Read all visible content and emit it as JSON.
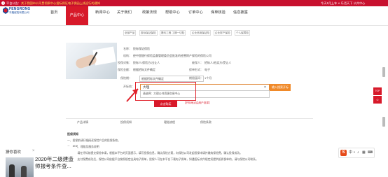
{
  "notice": {
    "icon": "!",
    "text_lead": "平台公告：",
    "text_highlight": "关于我国市公司贯彻原中心投标保证电子保函上线运行的通知",
    "right": "今天1月上年 ∨ 乐活天下 公共中心"
  },
  "brand": {
    "name": "FENGRONG",
    "subtitle": "丰融保险有限公司"
  },
  "nav": {
    "items": [
      "首页",
      "新闻中心",
      "关于我们",
      "政策法规",
      "帮助中心",
      "订单中心",
      "保单核验",
      "信息披露"
    ],
    "active": "产品中心"
  },
  "categories": [
    "全部产品",
    "投标保证保险",
    "履约工程 工期一切险",
    "企业信用保证险",
    "企业财产保险",
    "个人保障险"
  ],
  "product": {
    "fields": [
      {
        "label": "名称：",
        "value": "投标保证保险"
      },
      {
        "label": "机构：",
        "value": "经中国银行保险监督管理委员会批准的经营财产保险的保险公司"
      },
      {
        "label": "投保对象：",
        "value": "投标人/保险方/出让人",
        "extra_label": "被保人：",
        "extra_value": "招标人/拍卖方/受让人"
      },
      {
        "label": "保险金额：",
        "value": "根据招标文件确定",
        "extra_label": "保单形式：",
        "extra_value": "电子"
      },
      {
        "label": "保险期：",
        "value": "根据招标文件确定",
        "extra_label": "期限区间：",
        "extra_value": "1个月"
      }
    ],
    "select_label": "开标地：",
    "search_value": "大理",
    "search_clear": "×",
    "search_button": "输入搜索开标",
    "dropdown_lead": "大理",
    "dropdown_item": "请选择：大理公共资源交易中心",
    "hint": "开标地点请按照招标文件",
    "submit": "点击购买",
    "submit_note": "【开标地点由用户选择】"
  },
  "detail_tabs": [
    "产品详情",
    "投保须知",
    "理赔流程",
    "保险条款"
  ],
  "content": {
    "heading": "投保须知",
    "lines": [
      "一、投保前请仔细阅读保险产品的投保条款。",
      "二、投保、理赔及服务说明",
      "1 投保人请在评标前提交保险申请，根据本平台的页面提示，填写投保信息，确认保险方案，向保险公司发起投保申请并缴纳保险费，确认投保成功。",
      "2 投保人支付保费成功后，保险公司依据平台按照规定出具电子保单，投保人可在本平台下载电子保单，如遇招标文件规定须提供纸质保单的，请与保险公司联系。"
    ]
  },
  "side": {
    "top": "TOP",
    "top2": "TOP"
  },
  "news_popup": {
    "title": "猜你喜欢",
    "headline_1": "2020年二级建造",
    "headline_2": "师报考条件查...",
    "close": "×"
  },
  "ime": {
    "logo": "S",
    "items": [
      "中",
      "•",
      "♪",
      "▦",
      "⌨"
    ]
  },
  "colors": {
    "brand_red": "#d7192a",
    "accent_orange": "#f08a2a",
    "link_blue": "#1a4e9e"
  }
}
